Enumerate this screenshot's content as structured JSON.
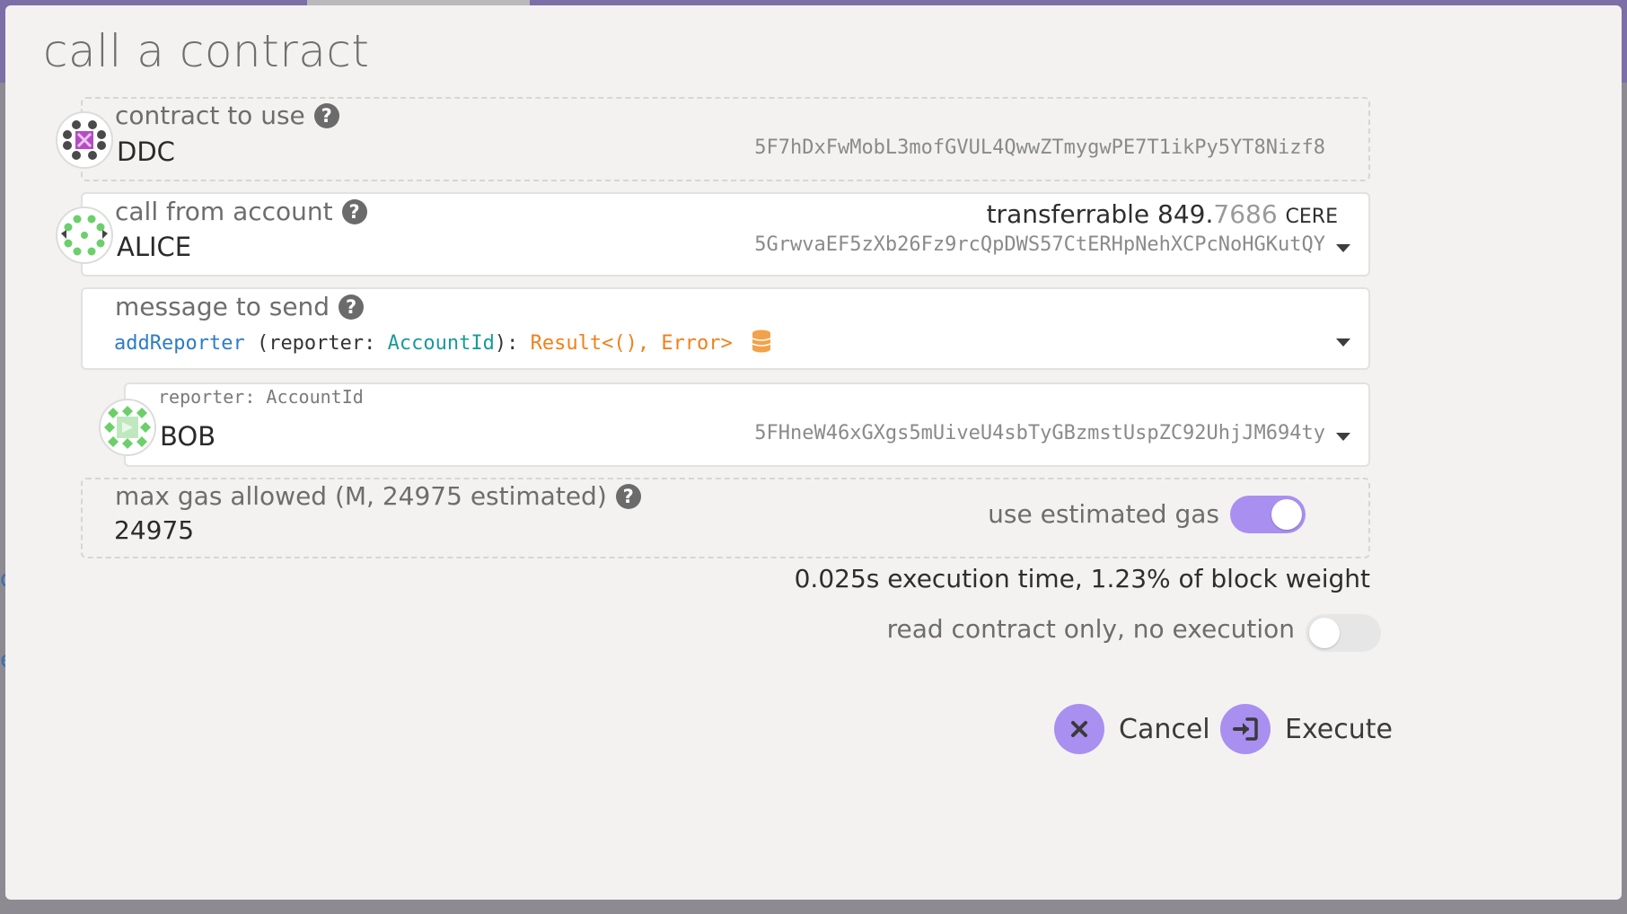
{
  "dialog": {
    "title": "call a contract"
  },
  "contract": {
    "label": "contract to use",
    "name": "DDC",
    "address": "5F7hDxFwMobL3mofGVUL4QwwZTmygwPE7T1ikPy5YT8Nizf8"
  },
  "account": {
    "label": "call from account",
    "name": "ALICE",
    "address": "5GrwvaEF5zXb26Fz9rcQpDWS57CtERHpNehXCPcNoHGKutQY",
    "balance_label": "transferrable",
    "balance_int": "849.",
    "balance_frac": "7686",
    "balance_unit": "CERE"
  },
  "message": {
    "label": "message to send",
    "method": "addReporter",
    "param_open": " (reporter: ",
    "param_type": "AccountId",
    "param_close": "): ",
    "return_type": "Result<(), Error>"
  },
  "param": {
    "label": "reporter: AccountId",
    "name": "BOB",
    "address": "5FHneW46xGXgs5mUiveU4sbTyGBzmstUspZC92UhjJM694ty"
  },
  "gas": {
    "label": "max gas allowed (M, 24975 estimated)",
    "value": "24975",
    "use_estimated_label": "use estimated gas",
    "use_estimated_on": true
  },
  "execution_info": "0.025s execution time, 1.23% of block weight",
  "read_only": {
    "label": "read contract only, no execution",
    "on": false
  },
  "buttons": {
    "cancel": "Cancel",
    "execute": "Execute"
  },
  "colors": {
    "accent": "#a98ff0",
    "method_blue": "#2f7bc7",
    "type_teal": "#1a9a9a",
    "return_orange": "#f0801a",
    "identicon_green": "#6ccf6c"
  }
}
